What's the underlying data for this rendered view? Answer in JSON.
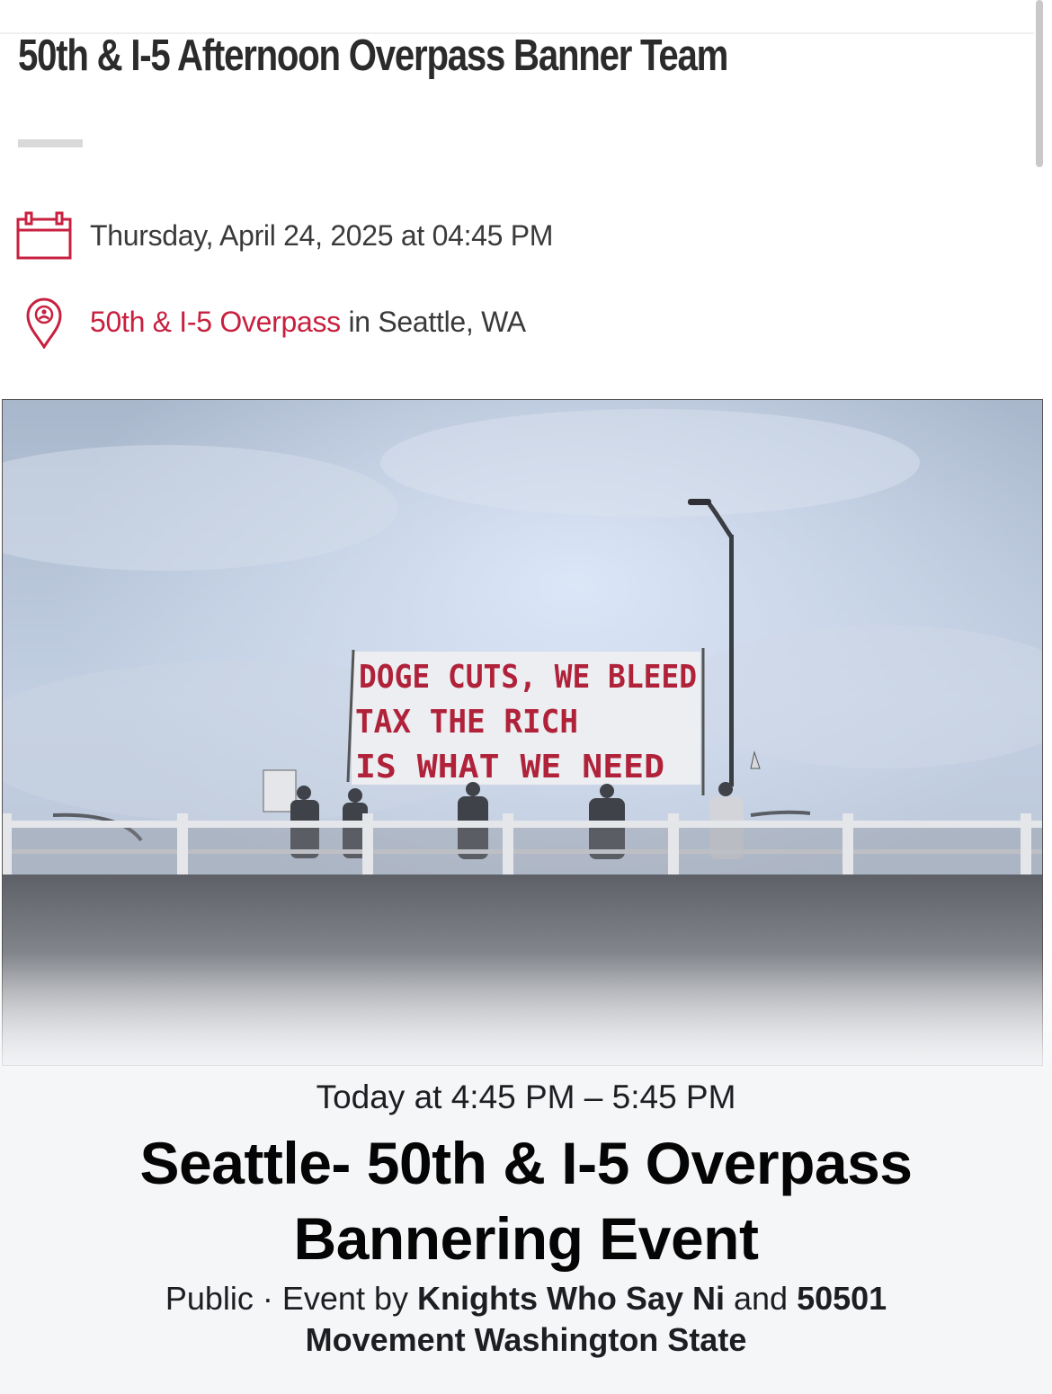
{
  "header": {
    "title": "50th & I-5 Afternoon Overpass Banner Team"
  },
  "event_info": {
    "date_time": "Thursday, April 24, 2025 at 04:45 PM",
    "location_link": "50th & I-5 Overpass",
    "location_suffix": " in Seattle, WA"
  },
  "photo": {
    "banner_lines": [
      "DOGE CUTS, WE BLEED",
      "TAX THE RICH",
      "IS WHAT WE NEED"
    ]
  },
  "fb_event": {
    "time_range": "Today at 4:45 PM – 5:45 PM",
    "title": "Seattle- 50th & I-5 Overpass Bannering Event",
    "visibility": "Public",
    "separator": " · ",
    "event_by_prefix": "Event by ",
    "host_1": "Knights Who Say Ni",
    "conjunction": " and ",
    "host_2": "50501 Movement Washington State"
  },
  "colors": {
    "accent_red": "#c8203f",
    "header_text": "#2b2b2b",
    "sky": "#b9c6d8",
    "banner_text": "#b0223a"
  },
  "icons": [
    "calendar-icon",
    "location-pin-icon"
  ]
}
